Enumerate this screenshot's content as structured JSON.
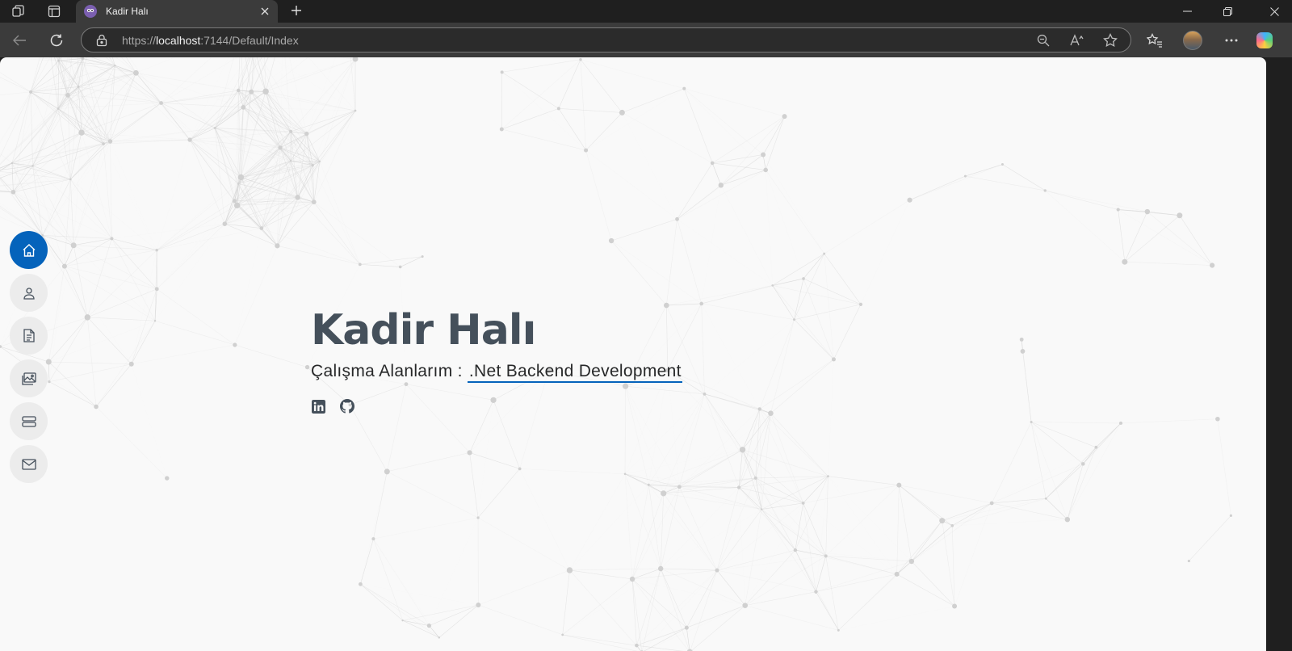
{
  "browser": {
    "tab": {
      "title": "Kadir Halı"
    },
    "url": {
      "scheme": "https://",
      "host": "localhost",
      "rest": ":7144/Default/Index"
    }
  },
  "hero": {
    "name": "Kadir Halı",
    "subtitle_prefix": "Çalışma Alanlarım : ",
    "typed_text": ".Net Backend Development"
  },
  "nav": {
    "items": [
      {
        "name": "home",
        "icon": "house-icon",
        "active": true
      },
      {
        "name": "about",
        "icon": "person-icon",
        "active": false
      },
      {
        "name": "resume",
        "icon": "file-text-icon",
        "active": false
      },
      {
        "name": "portfolio",
        "icon": "images-icon",
        "active": false
      },
      {
        "name": "services",
        "icon": "server-icon",
        "active": false
      },
      {
        "name": "contact",
        "icon": "envelope-icon",
        "active": false
      }
    ]
  },
  "social": [
    {
      "name": "linkedin",
      "icon": "linkedin-icon"
    },
    {
      "name": "github",
      "icon": "github-icon"
    }
  ],
  "colors": {
    "accent": "#0563bb",
    "heading": "#45505b",
    "page_bg": "#f9f9f9"
  }
}
